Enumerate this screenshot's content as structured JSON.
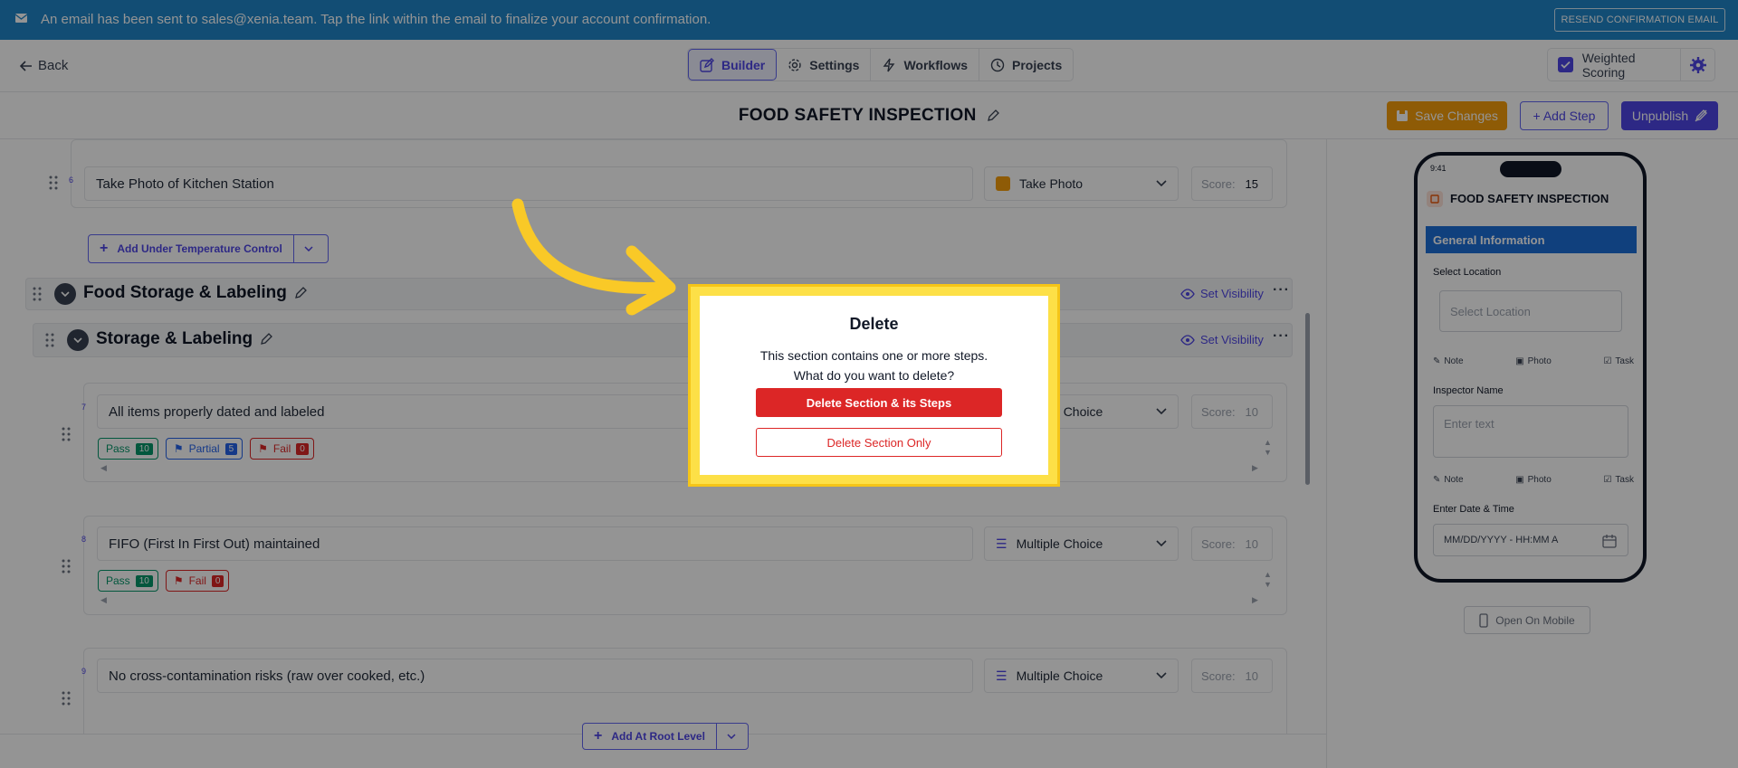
{
  "banner": {
    "message": "An email has been sent to sales@xenia.team. Tap the link within the email to finalize your account confirmation.",
    "resend_label": "RESEND CONFIRMATION EMAIL"
  },
  "nav": {
    "back_label": "Back",
    "tabs": [
      {
        "label": "Builder",
        "icon": "edit-icon",
        "active": true
      },
      {
        "label": "Settings",
        "icon": "gear-icon",
        "active": false
      },
      {
        "label": "Workflows",
        "icon": "bolt-icon",
        "active": false
      },
      {
        "label": "Projects",
        "icon": "clock-icon",
        "active": false
      }
    ],
    "weighted_scoring_label": "Weighted Scoring",
    "weighted_scoring_checked": true
  },
  "header": {
    "title": "FOOD SAFETY INSPECTION",
    "save_label": "Save Changes",
    "add_step_label": "+ Add Step",
    "unpublish_label": "Unpublish"
  },
  "builder": {
    "step6": {
      "number": "6",
      "title": "Take Photo of Kitchen Station",
      "type": "Take Photo",
      "score_label": "Score:",
      "score": "15"
    },
    "add_under_label": "Add Under Temperature Control",
    "section_food": {
      "title": "Food Storage & Labeling",
      "visibility_label": "Set Visibility"
    },
    "section_storage": {
      "title": "Storage & Labeling",
      "visibility_label": "Set Visibility"
    },
    "step7": {
      "number": "7",
      "title": "All items properly dated and labeled",
      "type": "Multiple Choice",
      "score_label": "Score:",
      "score": "10",
      "options": [
        {
          "label": "Pass",
          "score": "10"
        },
        {
          "label": "Partial",
          "score": "5"
        },
        {
          "label": "Fail",
          "score": "0"
        }
      ]
    },
    "step8": {
      "number": "8",
      "title": "FIFO (First In First Out) maintained",
      "type": "Multiple Choice",
      "score_label": "Score:",
      "score": "10",
      "options": [
        {
          "label": "Pass",
          "score": "10"
        },
        {
          "label": "Fail",
          "score": "0"
        }
      ]
    },
    "step9": {
      "number": "9",
      "title": "No cross-contamination risks (raw over cooked, etc.)",
      "type": "Multiple Choice",
      "score_label": "Score:",
      "score": "10"
    },
    "add_root_label": "Add At Root Level"
  },
  "preview": {
    "time": "9:41",
    "title": "FOOD SAFETY INSPECTION",
    "section": "General Information",
    "fields": [
      {
        "label": "Select Location",
        "placeholder": "Select Location"
      },
      {
        "label": "Inspector Name",
        "placeholder": "Enter text"
      },
      {
        "label": "Enter Date & Time",
        "placeholder": "MM/DD/YYYY - HH:MM A"
      }
    ],
    "actions": {
      "note": "Note",
      "photo": "Photo",
      "task": "Task"
    },
    "open_mobile_label": "Open On Mobile"
  },
  "modal": {
    "title": "Delete",
    "line1": "This section contains one or more steps.",
    "line2": "What do you want to delete?",
    "delete_all_label": "Delete Section & its Steps",
    "delete_section_only_label": "Delete Section Only"
  },
  "colors": {
    "banner": "#1f86c9",
    "accent": "#4f46e5",
    "danger": "#dc2626",
    "save": "#f59e0b",
    "highlight": "#fde047"
  }
}
